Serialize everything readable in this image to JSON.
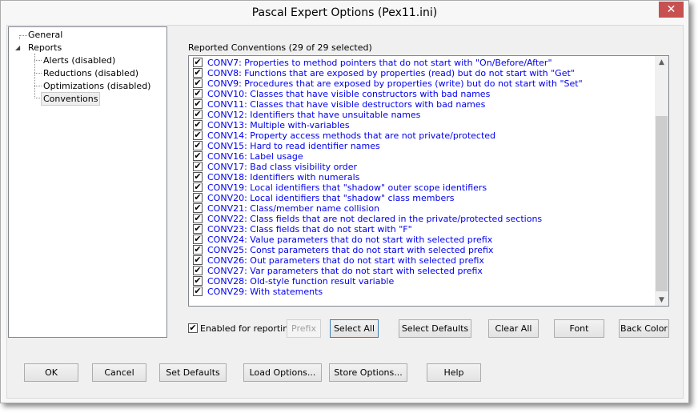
{
  "window": {
    "title": "Pascal Expert Options (Pex11.ini)",
    "close_icon": "close-icon"
  },
  "tree": {
    "items": [
      {
        "label": "General"
      },
      {
        "label": "Reports",
        "expanded": true,
        "children": [
          {
            "label": "Alerts (disabled)"
          },
          {
            "label": "Reductions (disabled)"
          },
          {
            "label": "Optimizations (disabled)"
          },
          {
            "label": "Conventions",
            "selected": true
          }
        ]
      }
    ]
  },
  "conventions": {
    "heading": "Reported Conventions (29 of 29 selected)",
    "scroll_position_percent": 100,
    "items": [
      {
        "label": "CONV7: Properties to method pointers that do not start with \"On/Before/After\"",
        "checked": true
      },
      {
        "label": "CONV8: Functions that are exposed by properties (read) but do not start with \"Get\"",
        "checked": true
      },
      {
        "label": "CONV9: Procedures that are exposed by properties (write) but do not start with \"Set\"",
        "checked": true
      },
      {
        "label": "CONV10: Classes that have visible constructors with bad names",
        "checked": true
      },
      {
        "label": "CONV11: Classes that have visible destructors with bad names",
        "checked": true
      },
      {
        "label": "CONV12: Identifiers that have unsuitable names",
        "checked": true
      },
      {
        "label": "CONV13: Multiple with-variables",
        "checked": true
      },
      {
        "label": "CONV14: Property access methods that are not private/protected",
        "checked": true
      },
      {
        "label": "CONV15: Hard to read identifier names",
        "checked": true
      },
      {
        "label": "CONV16: Label usage",
        "checked": true
      },
      {
        "label": "CONV17: Bad class visibility order",
        "checked": true
      },
      {
        "label": "CONV18: Identifiers with numerals",
        "checked": true
      },
      {
        "label": "CONV19: Local identifiers that \"shadow\" outer scope identifiers",
        "checked": true
      },
      {
        "label": "CONV20: Local identifiers that \"shadow\" class members",
        "checked": true
      },
      {
        "label": "CONV21: Class/member name collision",
        "checked": true
      },
      {
        "label": "CONV22: Class fields that are not declared in the private/protected sections",
        "checked": true
      },
      {
        "label": "CONV23: Class fields that do not start with \"F\"",
        "checked": true
      },
      {
        "label": "CONV24: Value parameters that do not start with selected prefix",
        "checked": true
      },
      {
        "label": "CONV25: Const parameters that do not start with selected prefix",
        "checked": true
      },
      {
        "label": "CONV26: Out parameters that do not start with selected prefix",
        "checked": true
      },
      {
        "label": "CONV27: Var parameters that do not start with selected prefix",
        "checked": true
      },
      {
        "label": "CONV28: Old-style function result variable",
        "checked": true
      },
      {
        "label": "CONV29: With statements",
        "checked": true
      }
    ],
    "item_color": "#0000ee"
  },
  "controls": {
    "enabled_label": "Enabled for reporting",
    "enabled_checked": true,
    "prefix": "Prefix",
    "select_all": "Select All",
    "select_defaults": "Select Defaults",
    "clear_all": "Clear All",
    "font": "Font",
    "back_color": "Back Color"
  },
  "footer": {
    "ok": "OK",
    "cancel": "Cancel",
    "set_defaults": "Set Defaults",
    "load_options": "Load Options...",
    "store_options": "Store Options...",
    "help": "Help"
  }
}
